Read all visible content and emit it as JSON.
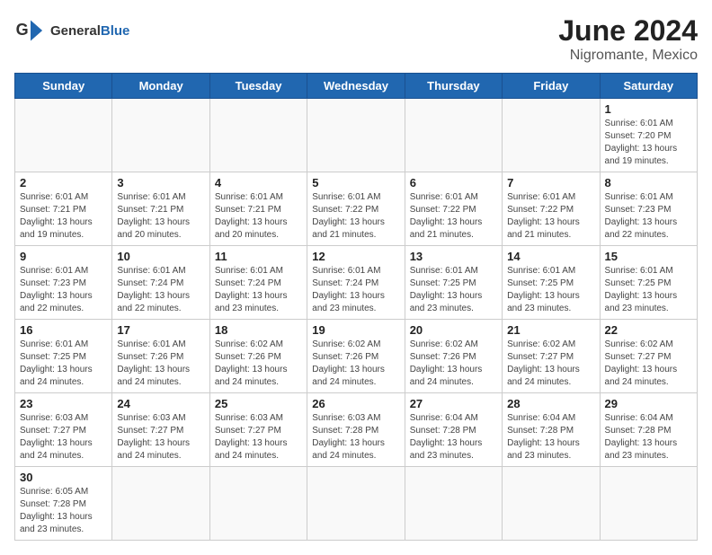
{
  "header": {
    "logo_general": "General",
    "logo_blue": "Blue",
    "month": "June 2024",
    "location": "Nigromante, Mexico"
  },
  "weekdays": [
    "Sunday",
    "Monday",
    "Tuesday",
    "Wednesday",
    "Thursday",
    "Friday",
    "Saturday"
  ],
  "weeks": [
    [
      {
        "day": null,
        "info": null
      },
      {
        "day": null,
        "info": null
      },
      {
        "day": null,
        "info": null
      },
      {
        "day": null,
        "info": null
      },
      {
        "day": null,
        "info": null
      },
      {
        "day": null,
        "info": null
      },
      {
        "day": "1",
        "info": "Sunrise: 6:01 AM\nSunset: 7:20 PM\nDaylight: 13 hours and 19 minutes."
      }
    ],
    [
      {
        "day": "2",
        "info": "Sunrise: 6:01 AM\nSunset: 7:21 PM\nDaylight: 13 hours and 19 minutes."
      },
      {
        "day": "3",
        "info": "Sunrise: 6:01 AM\nSunset: 7:21 PM\nDaylight: 13 hours and 20 minutes."
      },
      {
        "day": "4",
        "info": "Sunrise: 6:01 AM\nSunset: 7:21 PM\nDaylight: 13 hours and 20 minutes."
      },
      {
        "day": "5",
        "info": "Sunrise: 6:01 AM\nSunset: 7:22 PM\nDaylight: 13 hours and 21 minutes."
      },
      {
        "day": "6",
        "info": "Sunrise: 6:01 AM\nSunset: 7:22 PM\nDaylight: 13 hours and 21 minutes."
      },
      {
        "day": "7",
        "info": "Sunrise: 6:01 AM\nSunset: 7:22 PM\nDaylight: 13 hours and 21 minutes."
      },
      {
        "day": "8",
        "info": "Sunrise: 6:01 AM\nSunset: 7:23 PM\nDaylight: 13 hours and 22 minutes."
      }
    ],
    [
      {
        "day": "9",
        "info": "Sunrise: 6:01 AM\nSunset: 7:23 PM\nDaylight: 13 hours and 22 minutes."
      },
      {
        "day": "10",
        "info": "Sunrise: 6:01 AM\nSunset: 7:24 PM\nDaylight: 13 hours and 22 minutes."
      },
      {
        "day": "11",
        "info": "Sunrise: 6:01 AM\nSunset: 7:24 PM\nDaylight: 13 hours and 23 minutes."
      },
      {
        "day": "12",
        "info": "Sunrise: 6:01 AM\nSunset: 7:24 PM\nDaylight: 13 hours and 23 minutes."
      },
      {
        "day": "13",
        "info": "Sunrise: 6:01 AM\nSunset: 7:25 PM\nDaylight: 13 hours and 23 minutes."
      },
      {
        "day": "14",
        "info": "Sunrise: 6:01 AM\nSunset: 7:25 PM\nDaylight: 13 hours and 23 minutes."
      },
      {
        "day": "15",
        "info": "Sunrise: 6:01 AM\nSunset: 7:25 PM\nDaylight: 13 hours and 23 minutes."
      }
    ],
    [
      {
        "day": "16",
        "info": "Sunrise: 6:01 AM\nSunset: 7:25 PM\nDaylight: 13 hours and 24 minutes."
      },
      {
        "day": "17",
        "info": "Sunrise: 6:01 AM\nSunset: 7:26 PM\nDaylight: 13 hours and 24 minutes."
      },
      {
        "day": "18",
        "info": "Sunrise: 6:02 AM\nSunset: 7:26 PM\nDaylight: 13 hours and 24 minutes."
      },
      {
        "day": "19",
        "info": "Sunrise: 6:02 AM\nSunset: 7:26 PM\nDaylight: 13 hours and 24 minutes."
      },
      {
        "day": "20",
        "info": "Sunrise: 6:02 AM\nSunset: 7:26 PM\nDaylight: 13 hours and 24 minutes."
      },
      {
        "day": "21",
        "info": "Sunrise: 6:02 AM\nSunset: 7:27 PM\nDaylight: 13 hours and 24 minutes."
      },
      {
        "day": "22",
        "info": "Sunrise: 6:02 AM\nSunset: 7:27 PM\nDaylight: 13 hours and 24 minutes."
      }
    ],
    [
      {
        "day": "23",
        "info": "Sunrise: 6:03 AM\nSunset: 7:27 PM\nDaylight: 13 hours and 24 minutes."
      },
      {
        "day": "24",
        "info": "Sunrise: 6:03 AM\nSunset: 7:27 PM\nDaylight: 13 hours and 24 minutes."
      },
      {
        "day": "25",
        "info": "Sunrise: 6:03 AM\nSunset: 7:27 PM\nDaylight: 13 hours and 24 minutes."
      },
      {
        "day": "26",
        "info": "Sunrise: 6:03 AM\nSunset: 7:28 PM\nDaylight: 13 hours and 24 minutes."
      },
      {
        "day": "27",
        "info": "Sunrise: 6:04 AM\nSunset: 7:28 PM\nDaylight: 13 hours and 23 minutes."
      },
      {
        "day": "28",
        "info": "Sunrise: 6:04 AM\nSunset: 7:28 PM\nDaylight: 13 hours and 23 minutes."
      },
      {
        "day": "29",
        "info": "Sunrise: 6:04 AM\nSunset: 7:28 PM\nDaylight: 13 hours and 23 minutes."
      }
    ],
    [
      {
        "day": "30",
        "info": "Sunrise: 6:05 AM\nSunset: 7:28 PM\nDaylight: 13 hours and 23 minutes."
      },
      {
        "day": null,
        "info": null
      },
      {
        "day": null,
        "info": null
      },
      {
        "day": null,
        "info": null
      },
      {
        "day": null,
        "info": null
      },
      {
        "day": null,
        "info": null
      },
      {
        "day": null,
        "info": null
      }
    ]
  ]
}
